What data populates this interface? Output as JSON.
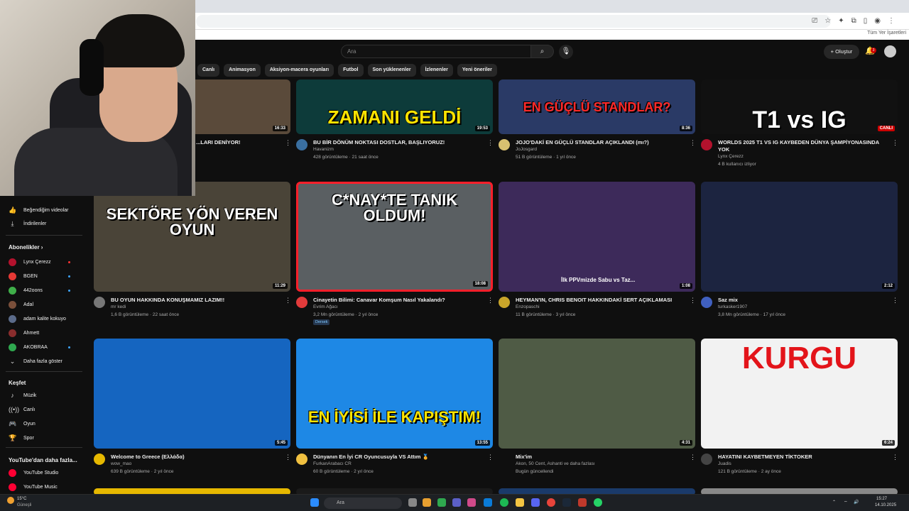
{
  "browser": {
    "bookmarks_label": "Tüm Yer İşaretleri"
  },
  "header": {
    "search_placeholder": "Ara",
    "create_label": "+ Oluştur",
    "notifications_count": "3"
  },
  "chips": [
    "Canlı",
    "Animasyon",
    "Aksiyon-macera oyunları",
    "Futbol",
    "Son yüklenenler",
    "İzlenenler",
    "Yeni öneriler"
  ],
  "sidebar": {
    "liked": "Beğendiğim videolar",
    "downloads": "İndirilenler",
    "subscriptions_title": "Abonelikler",
    "subscriptions": [
      {
        "name": "Lynx Çerezz",
        "color": "#b3122d",
        "live": true
      },
      {
        "name": "BGEN",
        "color": "#e53935",
        "new": true
      },
      {
        "name": "442oons",
        "color": "#3fae49",
        "new": true
      },
      {
        "name": "Adal",
        "color": "#7a4f3a",
        "new": false
      },
      {
        "name": "adam kalite kokuyo",
        "color": "#5b6b8a",
        "new": false
      },
      {
        "name": "Ahmett",
        "color": "#8a2d2d",
        "new": false
      },
      {
        "name": "AKOBRAA",
        "color": "#2fa84f",
        "new": true
      }
    ],
    "more": "Daha fazla göster",
    "explore_title": "Keşfet",
    "explore": [
      "Müzik",
      "Canlı",
      "Oyun",
      "Spor"
    ],
    "more_from_title": "YouTube'dan daha fazla...",
    "more_from": [
      {
        "name": "YouTube Studio",
        "color": "#ff0033"
      },
      {
        "name": "YouTube Music",
        "color": "#ff0033"
      }
    ]
  },
  "videos": [
    {
      "title": "...LARI DENİYOR!",
      "channel": "",
      "meta": "",
      "duration": "16:33",
      "thumb_text": "",
      "thumb_bg": "#5a4a3a",
      "av": "#886644"
    },
    {
      "title": "BU BİR DÖNÜM NOKTASI DOSTLAR, BAŞLIYORUZ!",
      "channel": "Havanizm",
      "meta": "428 görüntüleme · 21 saat önce",
      "duration": "19:53",
      "thumb_text": "ZAMANI GELDİ",
      "thumb_bg": "#0d3b3a",
      "av": "#3a6fa0"
    },
    {
      "title": "JOJO'DAKİ EN GÜÇLÜ STANDLAR AÇIKLANDI (mı?)",
      "channel": "JoJosgard",
      "meta": "51 B görüntüleme · 1 yıl önce",
      "duration": "8:36",
      "thumb_text": "EN GÜÇLÜ STANDLAR?",
      "thumb_bg": "#2a3a66",
      "av": "#d8c070"
    },
    {
      "title": "WORLDS 2025 T1 VS IG KAYBEDEN DÜNYA ŞAMPİYONASINDA YOK",
      "channel": "Lynx Çerezz",
      "meta": "4 B kullanıcı izliyor",
      "duration": "CANLI",
      "thumb_text": "T1 vs IG",
      "thumb_bg": "#111111",
      "av": "#b3122d"
    },
    {
      "title": "BU OYUN HAKKINDA KONUŞMAMIZ LAZIM!!",
      "channel": "mr kedi",
      "meta": "1,6 B görüntüleme · 22 saat önce",
      "duration": "11:29",
      "thumb_text": "SEKTÖRE YÖN VEREN OYUN",
      "thumb_bg": "#4a4438",
      "av": "#777"
    },
    {
      "title": "Cinayetin Bilimi: Canavar Komşum Nasıl Yakalandı?",
      "channel": "Evrim Ağacı",
      "meta": "3,2 Mn görüntüleme · 2 yıl önce",
      "duration": "18:08",
      "thumb_text": "C*NAY*TE TANIK OLDUM!",
      "thumb_bg": "#5a5f62",
      "av": "#e23b3b",
      "badge": "Dersek"
    },
    {
      "title": "HEYMAN'IN, CHRIS BENOIT HAKKINDAKİ SERT AÇIKLAMASI",
      "channel": "Enzopaschi",
      "meta": "11 B görüntüleme · 3 yıl önce",
      "duration": "1:08",
      "thumb_text": "İlk PPVmizde Sabu vs Taz...",
      "thumb_bg": "#3d2a5a",
      "av": "#c9a52a"
    },
    {
      "title": "Saz mix",
      "channel": "turkasker1907",
      "meta": "3,8 Mn görüntüleme · 17 yıl önce",
      "duration": "2:12",
      "thumb_text": "",
      "thumb_bg": "#1c2440",
      "av": "#4060c0"
    },
    {
      "title": "Welcome to Greece (Ελλάδα)",
      "channel": "wow_mao",
      "meta": "639 B görüntüleme · 2 yıl önce",
      "duration": "5:45",
      "thumb_text": "",
      "thumb_bg": "#1565c0",
      "av": "#e6b800"
    },
    {
      "title": "Dünyanın En İyi CR Oyuncusuyla VS Attım 🏅",
      "channel": "FurkanArabacı CR",
      "meta": "60 B görüntüleme · 2 yıl önce",
      "duration": "13:55",
      "thumb_text": "EN İYİSİ İLE KAPIŞTIM!",
      "thumb_bg": "#1e88e5",
      "av": "#f0c040"
    },
    {
      "title": "Mix'im",
      "channel": "Akon, 50 Cent, Ashanti ve daha fazlası",
      "meta": "Bugün güncellendi",
      "duration": "4:31",
      "thumb_text": "",
      "thumb_bg": "#4f5b45",
      "av": ""
    },
    {
      "title": "HAYATINI KAYBETMEYEN TİKTOKER",
      "channel": "Juadis",
      "meta": "121 B görüntüleme · 2 ay önce",
      "duration": "6:24",
      "thumb_text": "KURGU",
      "thumb_bg": "#f2f2f2",
      "av": "#444"
    }
  ],
  "taskbar": {
    "weather_temp": "15°C",
    "weather_label": "Güneşli",
    "search": "Ara",
    "time": "15:27",
    "date": "14.10.2025"
  }
}
